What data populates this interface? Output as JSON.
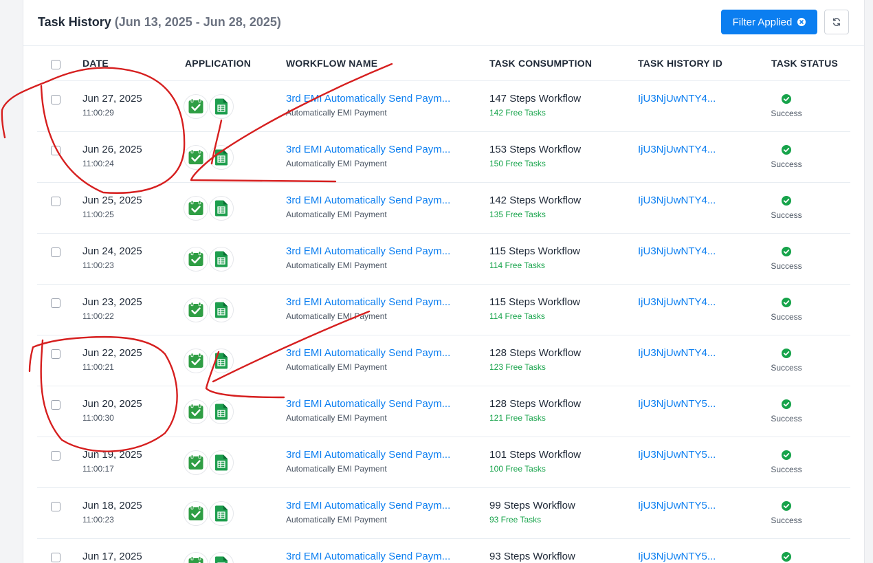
{
  "header": {
    "title": "Task History",
    "date_range": "(Jun 13, 2025 - Jun 28, 2025)",
    "filter_button": "Filter Applied"
  },
  "columns": {
    "date": "DATE",
    "application": "APPLICATION",
    "workflow_name": "WORKFLOW NAME",
    "task_consumption": "TASK CONSUMPTION",
    "task_history_id": "TASK HISTORY ID",
    "task_status": "TASK STATUS"
  },
  "colors": {
    "accent": "#0b7ef0",
    "success": "#16a34a",
    "annotation": "#d61f1f"
  },
  "rows": [
    {
      "date": "Jun 27, 2025",
      "time": "11:00:29",
      "workflow": "3rd EMI Automatically Send Paym...",
      "workflow_sub": "Automatically EMI Payment",
      "steps": "147 Steps Workflow",
      "free": "142 Free Tasks",
      "history_id": "IjU3NjUwNTY4...",
      "status": "Success"
    },
    {
      "date": "Jun 26, 2025",
      "time": "11:00:24",
      "workflow": "3rd EMI Automatically Send Paym...",
      "workflow_sub": "Automatically EMI Payment",
      "steps": "153 Steps Workflow",
      "free": "150 Free Tasks",
      "history_id": "IjU3NjUwNTY4...",
      "status": "Success"
    },
    {
      "date": "Jun 25, 2025",
      "time": "11:00:25",
      "workflow": "3rd EMI Automatically Send Paym...",
      "workflow_sub": "Automatically EMI Payment",
      "steps": "142 Steps Workflow",
      "free": "135 Free Tasks",
      "history_id": "IjU3NjUwNTY4...",
      "status": "Success"
    },
    {
      "date": "Jun 24, 2025",
      "time": "11:00:23",
      "workflow": "3rd EMI Automatically Send Paym...",
      "workflow_sub": "Automatically EMI Payment",
      "steps": "115 Steps Workflow",
      "free": "114 Free Tasks",
      "history_id": "IjU3NjUwNTY4...",
      "status": "Success"
    },
    {
      "date": "Jun 23, 2025",
      "time": "11:00:22",
      "workflow": "3rd EMI Automatically Send Paym...",
      "workflow_sub": "Automatically EMI Payment",
      "steps": "115 Steps Workflow",
      "free": "114 Free Tasks",
      "history_id": "IjU3NjUwNTY4...",
      "status": "Success"
    },
    {
      "date": "Jun 22, 2025",
      "time": "11:00:21",
      "workflow": "3rd EMI Automatically Send Paym...",
      "workflow_sub": "Automatically EMI Payment",
      "steps": "128 Steps Workflow",
      "free": "123 Free Tasks",
      "history_id": "IjU3NjUwNTY4...",
      "status": "Success"
    },
    {
      "date": "Jun 20, 2025",
      "time": "11:00:30",
      "workflow": "3rd EMI Automatically Send Paym...",
      "workflow_sub": "Automatically EMI Payment",
      "steps": "128 Steps Workflow",
      "free": "121 Free Tasks",
      "history_id": "IjU3NjUwNTY5...",
      "status": "Success"
    },
    {
      "date": "Jun 19, 2025",
      "time": "11:00:17",
      "workflow": "3rd EMI Automatically Send Paym...",
      "workflow_sub": "Automatically EMI Payment",
      "steps": "101 Steps Workflow",
      "free": "100 Free Tasks",
      "history_id": "IjU3NjUwNTY5...",
      "status": "Success"
    },
    {
      "date": "Jun 18, 2025",
      "time": "11:00:23",
      "workflow": "3rd EMI Automatically Send Paym...",
      "workflow_sub": "Automatically EMI Payment",
      "steps": "99 Steps Workflow",
      "free": "93 Free Tasks",
      "history_id": "IjU3NjUwNTY5...",
      "status": "Success"
    },
    {
      "date": "Jun 17, 2025",
      "time": "",
      "workflow": "3rd EMI Automatically Send Paym...",
      "workflow_sub": "",
      "steps": "93 Steps Workflow",
      "free": "",
      "history_id": "IjU3NjUwNTY5...",
      "status": ""
    }
  ]
}
